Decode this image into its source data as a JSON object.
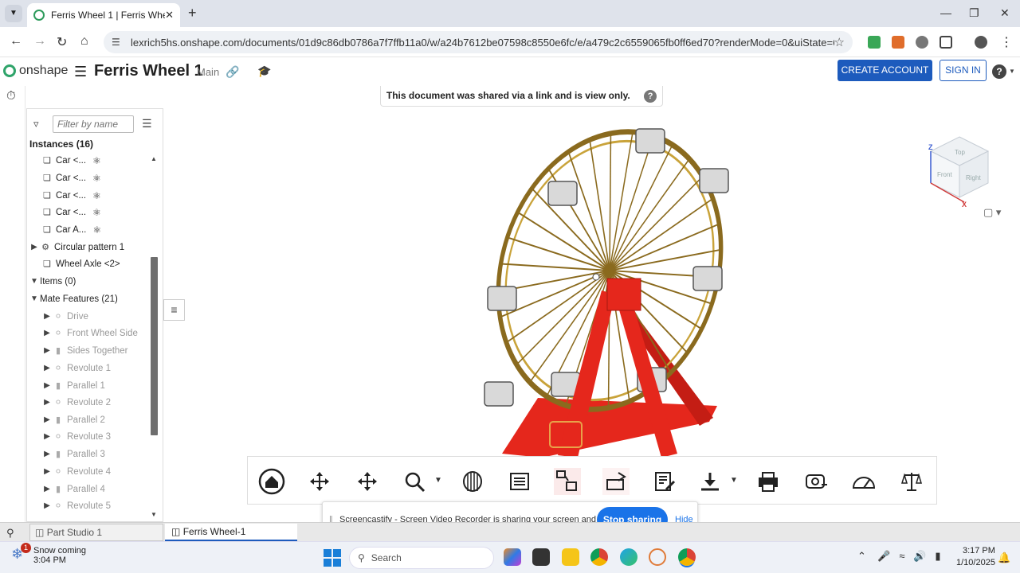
{
  "browser": {
    "tab_title": "Ferris Wheel 1 | Ferris Wheel-1",
    "url": "lexrich5hs.onshape.com/documents/01d9c86db0786a7f7ffb11a0/w/a24b7612be07598c8550e6fc/e/a479c2c6559065fb0ff6ed70?renderMode=0&uiState=67815b2a3d55..."
  },
  "app": {
    "logo_text": "onshape",
    "doc_title": "Ferris Wheel 1",
    "branch": "Main",
    "create_account": "CREATE ACCOUNT",
    "sign_in": "SIGN IN",
    "help": "?"
  },
  "banner": {
    "text": "This document was shared via a link and is view only.",
    "help": "?"
  },
  "tree": {
    "filter_placeholder": "Filter by name",
    "instances_header": "Instances (16)",
    "instances": [
      "Car <...",
      "Car <...",
      "Car <...",
      "Car <...",
      "Car A..."
    ],
    "circular_pattern": "Circular pattern 1",
    "wheel_axle": "Wheel Axle <2>",
    "items": "Items (0)",
    "mate_features": "Mate Features (21)",
    "mates": [
      "Drive",
      "Front Wheel Side",
      "Sides Together",
      "Revolute 1",
      "Parallel 1",
      "Revolute 2",
      "Parallel 2",
      "Revolute 3",
      "Parallel 3",
      "Revolute 4",
      "Parallel 4",
      "Revolute 5"
    ]
  },
  "viewcube": {
    "top": "Top",
    "front": "Front",
    "right": "Right",
    "z": "Z",
    "x": "X"
  },
  "screencastify": {
    "message": "Screencastify - Screen Video Recorder is sharing your screen and audio.",
    "stop": "Stop sharing",
    "hide": "Hide"
  },
  "bottom_tabs": {
    "tab1": "Part Studio 1",
    "tab2": "Ferris Wheel-1"
  },
  "taskbar": {
    "weather_title": "Snow coming",
    "weather_time": "3:04 PM",
    "badge": "1",
    "search": "Search",
    "time": "3:17 PM",
    "date": "1/10/2025"
  },
  "colors": {
    "accent": "#1d5bbd",
    "onshape_green": "#2fa46a",
    "wheel_gold": "#b08a2a",
    "frame_red": "#e5271c"
  }
}
